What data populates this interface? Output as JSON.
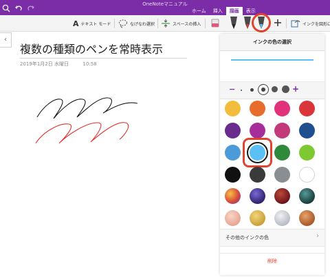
{
  "app": {
    "title": "OneNoteマニュアル"
  },
  "tabs": [
    {
      "label": "ホーム",
      "active": false
    },
    {
      "label": "挿入",
      "active": false
    },
    {
      "label": "描画",
      "active": true
    },
    {
      "label": "表示",
      "active": false
    }
  ],
  "ribbon": {
    "text_mode": "テキスト モード",
    "lasso": "なげなわ選択",
    "insert_space": "スペースの挿入",
    "ink_to_shape": "インクを図形に"
  },
  "page": {
    "title": "複数の種類のペンを常時表示",
    "date": "2019年1月2日 水曜日",
    "time": "10:58"
  },
  "ink_panel": {
    "title": "インクの色の選択",
    "minus": "−",
    "plus": "+",
    "more_colors": "その他のインクの色",
    "delete": "削除",
    "selected_color": "#5bc0f5",
    "colors": [
      [
        "#f2bd3c",
        "#e86c2c",
        "#e0317a",
        "#d9353a"
      ],
      [
        "#6a2b8f",
        "#a62e9a",
        "#c23a7a",
        "#1f4f8f"
      ],
      [
        "#4a9bd8",
        "#5bc0f5",
        "#2e8a3a",
        "#7ec832"
      ],
      [
        "#111111",
        "#3a3a3a",
        "#8a8e92",
        "#ffffff"
      ]
    ]
  },
  "colors": {
    "accent": "#7b2da8",
    "highlight": "#e0432e"
  }
}
